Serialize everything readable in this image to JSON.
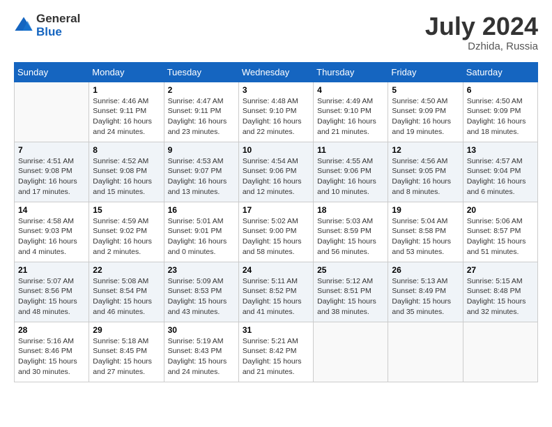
{
  "header": {
    "logo_general": "General",
    "logo_blue": "Blue",
    "month_year": "July 2024",
    "location": "Dzhida, Russia"
  },
  "weekdays": [
    "Sunday",
    "Monday",
    "Tuesday",
    "Wednesday",
    "Thursday",
    "Friday",
    "Saturday"
  ],
  "weeks": [
    [
      {
        "day": "",
        "info": ""
      },
      {
        "day": "1",
        "info": "Sunrise: 4:46 AM\nSunset: 9:11 PM\nDaylight: 16 hours\nand 24 minutes."
      },
      {
        "day": "2",
        "info": "Sunrise: 4:47 AM\nSunset: 9:11 PM\nDaylight: 16 hours\nand 23 minutes."
      },
      {
        "day": "3",
        "info": "Sunrise: 4:48 AM\nSunset: 9:10 PM\nDaylight: 16 hours\nand 22 minutes."
      },
      {
        "day": "4",
        "info": "Sunrise: 4:49 AM\nSunset: 9:10 PM\nDaylight: 16 hours\nand 21 minutes."
      },
      {
        "day": "5",
        "info": "Sunrise: 4:50 AM\nSunset: 9:09 PM\nDaylight: 16 hours\nand 19 minutes."
      },
      {
        "day": "6",
        "info": "Sunrise: 4:50 AM\nSunset: 9:09 PM\nDaylight: 16 hours\nand 18 minutes."
      }
    ],
    [
      {
        "day": "7",
        "info": "Sunrise: 4:51 AM\nSunset: 9:08 PM\nDaylight: 16 hours\nand 17 minutes."
      },
      {
        "day": "8",
        "info": "Sunrise: 4:52 AM\nSunset: 9:08 PM\nDaylight: 16 hours\nand 15 minutes."
      },
      {
        "day": "9",
        "info": "Sunrise: 4:53 AM\nSunset: 9:07 PM\nDaylight: 16 hours\nand 13 minutes."
      },
      {
        "day": "10",
        "info": "Sunrise: 4:54 AM\nSunset: 9:06 PM\nDaylight: 16 hours\nand 12 minutes."
      },
      {
        "day": "11",
        "info": "Sunrise: 4:55 AM\nSunset: 9:06 PM\nDaylight: 16 hours\nand 10 minutes."
      },
      {
        "day": "12",
        "info": "Sunrise: 4:56 AM\nSunset: 9:05 PM\nDaylight: 16 hours\nand 8 minutes."
      },
      {
        "day": "13",
        "info": "Sunrise: 4:57 AM\nSunset: 9:04 PM\nDaylight: 16 hours\nand 6 minutes."
      }
    ],
    [
      {
        "day": "14",
        "info": "Sunrise: 4:58 AM\nSunset: 9:03 PM\nDaylight: 16 hours\nand 4 minutes."
      },
      {
        "day": "15",
        "info": "Sunrise: 4:59 AM\nSunset: 9:02 PM\nDaylight: 16 hours\nand 2 minutes."
      },
      {
        "day": "16",
        "info": "Sunrise: 5:01 AM\nSunset: 9:01 PM\nDaylight: 16 hours\nand 0 minutes."
      },
      {
        "day": "17",
        "info": "Sunrise: 5:02 AM\nSunset: 9:00 PM\nDaylight: 15 hours\nand 58 minutes."
      },
      {
        "day": "18",
        "info": "Sunrise: 5:03 AM\nSunset: 8:59 PM\nDaylight: 15 hours\nand 56 minutes."
      },
      {
        "day": "19",
        "info": "Sunrise: 5:04 AM\nSunset: 8:58 PM\nDaylight: 15 hours\nand 53 minutes."
      },
      {
        "day": "20",
        "info": "Sunrise: 5:06 AM\nSunset: 8:57 PM\nDaylight: 15 hours\nand 51 minutes."
      }
    ],
    [
      {
        "day": "21",
        "info": "Sunrise: 5:07 AM\nSunset: 8:56 PM\nDaylight: 15 hours\nand 48 minutes."
      },
      {
        "day": "22",
        "info": "Sunrise: 5:08 AM\nSunset: 8:54 PM\nDaylight: 15 hours\nand 46 minutes."
      },
      {
        "day": "23",
        "info": "Sunrise: 5:09 AM\nSunset: 8:53 PM\nDaylight: 15 hours\nand 43 minutes."
      },
      {
        "day": "24",
        "info": "Sunrise: 5:11 AM\nSunset: 8:52 PM\nDaylight: 15 hours\nand 41 minutes."
      },
      {
        "day": "25",
        "info": "Sunrise: 5:12 AM\nSunset: 8:51 PM\nDaylight: 15 hours\nand 38 minutes."
      },
      {
        "day": "26",
        "info": "Sunrise: 5:13 AM\nSunset: 8:49 PM\nDaylight: 15 hours\nand 35 minutes."
      },
      {
        "day": "27",
        "info": "Sunrise: 5:15 AM\nSunset: 8:48 PM\nDaylight: 15 hours\nand 32 minutes."
      }
    ],
    [
      {
        "day": "28",
        "info": "Sunrise: 5:16 AM\nSunset: 8:46 PM\nDaylight: 15 hours\nand 30 minutes."
      },
      {
        "day": "29",
        "info": "Sunrise: 5:18 AM\nSunset: 8:45 PM\nDaylight: 15 hours\nand 27 minutes."
      },
      {
        "day": "30",
        "info": "Sunrise: 5:19 AM\nSunset: 8:43 PM\nDaylight: 15 hours\nand 24 minutes."
      },
      {
        "day": "31",
        "info": "Sunrise: 5:21 AM\nSunset: 8:42 PM\nDaylight: 15 hours\nand 21 minutes."
      },
      {
        "day": "",
        "info": ""
      },
      {
        "day": "",
        "info": ""
      },
      {
        "day": "",
        "info": ""
      }
    ]
  ]
}
